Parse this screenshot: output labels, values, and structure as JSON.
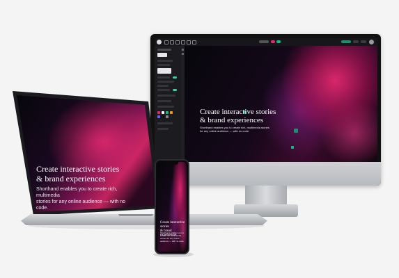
{
  "hero": {
    "headline_line1": "Create interactive stories",
    "headline_line2": "& brand experiences",
    "sub_line1": "Shorthand enables you to create rich, multimedia stories",
    "sub_line2": "for any online audience — with no code."
  },
  "laptop": {
    "headline_line1": "Create interactive stories",
    "headline_line2": "& brand experiences",
    "sub_line1": "Shorthand enables you to create rich, multimedia",
    "sub_line2": "stories for any online audience — with no code."
  },
  "phone": {
    "headline_line1": "Create interactive stories",
    "headline_line2": "& brand experiences",
    "sub": "Shorthand enables you to create rich, multimedia stories for any online audience — with no code."
  },
  "colors": {
    "accent": "#17b890",
    "hero_pink": "#e2286e",
    "background": "#f4f4f5"
  }
}
